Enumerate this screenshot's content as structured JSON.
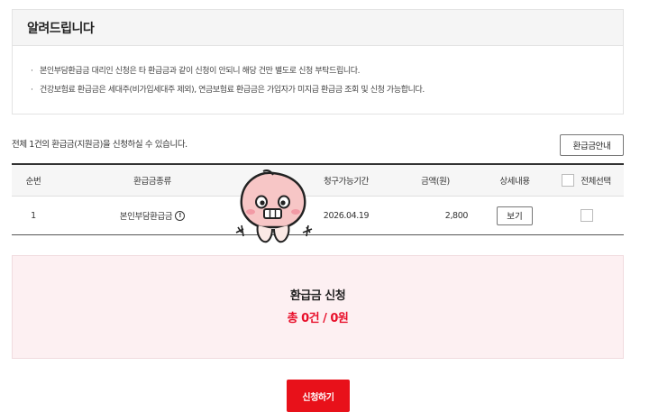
{
  "notice": {
    "title": "알려드립니다",
    "lines": [
      "본인부담환급금 대리인 신청은 타 환급금과 같이 신청이 안되니 해당 건만 별도로 신청 부탁드립니다.",
      "건강보험료 환급금은 세대주(비가입세대주 제외), 연금보험료 환급금은 가입자가 미지급 환급금 조회 및 신청 가능합니다."
    ]
  },
  "summary_text": "전체 1건의 환급금(지원금)을 신청하실 수 있습니다.",
  "guide_button": "환급금안내",
  "table": {
    "headers": {
      "no": "순번",
      "type": "환급금종류",
      "hidden": "",
      "period": "청구가능기간",
      "amount": "금액(원)",
      "detail": "상세내용",
      "select_all": "전체선택"
    },
    "rows": [
      {
        "no": "1",
        "type": "본인부담환급금",
        "period": "2026.04.19",
        "amount": "2,800",
        "detail_button": "보기"
      }
    ]
  },
  "total": {
    "title": "환급금 신청",
    "value": "총 0건 / 0원"
  },
  "apply_button": "신청하기",
  "colors": {
    "accent_red": "#e8111a",
    "total_bg": "#fdf0f2",
    "sticker_pink": "#f7c6c6"
  },
  "icons": {
    "info": "info-circle-icon",
    "sticker": "peach-character-sticker"
  }
}
